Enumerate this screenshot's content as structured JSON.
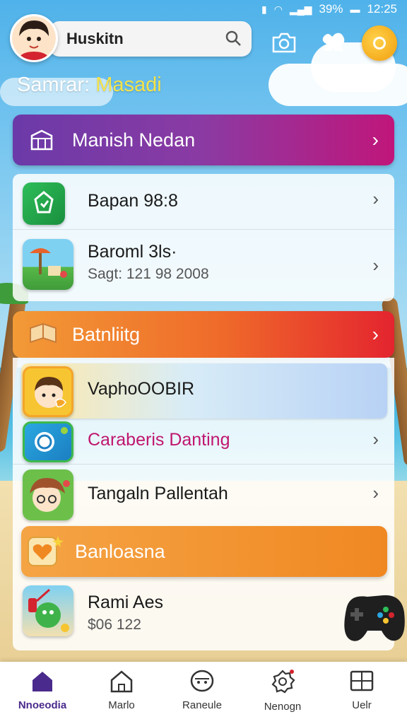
{
  "status_bar": {
    "battery": "39%",
    "time": "12:25"
  },
  "header": {
    "search_text": "Huskitn"
  },
  "greeting": {
    "prefix": "Samrar:",
    "name": "Masadi"
  },
  "sections": [
    {
      "title": "Manish Nedan"
    },
    {
      "title": "Batnliitg"
    },
    {
      "title": "Banloasna"
    }
  ],
  "rows": [
    {
      "title": "Bapan 98:8",
      "subtitle": ""
    },
    {
      "title": "Baroml 3ls·",
      "subtitle": "Sagt: 121 98 2008"
    },
    {
      "title": "VaphoOOBIR",
      "subtitle": ""
    },
    {
      "title": "Caraberis Danting",
      "subtitle": ""
    },
    {
      "title": "Tangaln Pallentah",
      "subtitle": ""
    },
    {
      "title": "Rami Aes",
      "subtitle": "$06 122"
    }
  ],
  "nav": [
    {
      "label": "Nnoeodia",
      "icon": "home-icon"
    },
    {
      "label": "Marlo",
      "icon": "house-outline-icon"
    },
    {
      "label": "Raneule",
      "icon": "face-icon"
    },
    {
      "label": "Nenogn",
      "icon": "gear-icon"
    },
    {
      "label": "Uelr",
      "icon": "grid-icon"
    }
  ],
  "colors": {
    "accent_purple": "#6b3aa8",
    "accent_orange": "#f08822",
    "coin": "#f29d0c",
    "link_pink": "#c0166f"
  }
}
